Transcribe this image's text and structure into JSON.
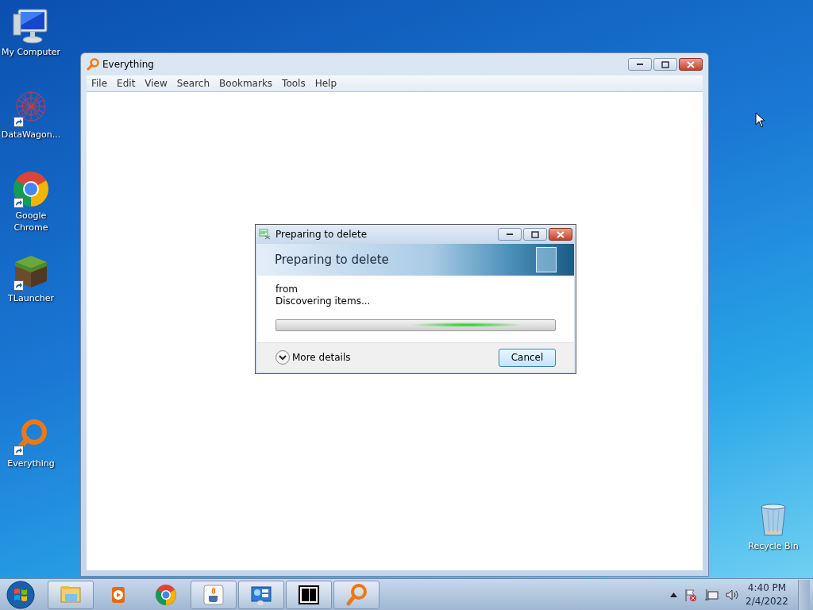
{
  "desktop_icons": [
    {
      "label": "My Computer",
      "kind": "computer",
      "shortcut": false
    },
    {
      "label": "DataWagon...",
      "kind": "network",
      "shortcut": true
    },
    {
      "label": "Google Chrome",
      "kind": "chrome",
      "shortcut": true
    },
    {
      "label": "TLauncher",
      "kind": "block",
      "shortcut": true
    },
    {
      "label": "Everything",
      "kind": "everything",
      "shortcut": true
    },
    {
      "label": "Recycle Bin",
      "kind": "bin",
      "shortcut": false
    }
  ],
  "main_window": {
    "title": "Everything",
    "menu": [
      "File",
      "Edit",
      "View",
      "Search",
      "Bookmarks",
      "Tools",
      "Help"
    ]
  },
  "dialog": {
    "title": "Preparing to delete",
    "heading": "Preparing to delete",
    "lines": [
      "from",
      "Discovering items..."
    ],
    "progress": {
      "marquee": true
    },
    "details": "More details",
    "button": "Cancel"
  },
  "taskbar": {
    "items": [
      {
        "kind": "explorer",
        "running": true
      },
      {
        "kind": "media",
        "running": false
      },
      {
        "kind": "chrome",
        "running": false
      },
      {
        "kind": "java",
        "running": true
      },
      {
        "kind": "panel",
        "running": true
      },
      {
        "kind": "zip",
        "running": true
      },
      {
        "kind": "everything",
        "running": true
      }
    ],
    "time": "4:40 PM",
    "date": "2/4/2022"
  }
}
